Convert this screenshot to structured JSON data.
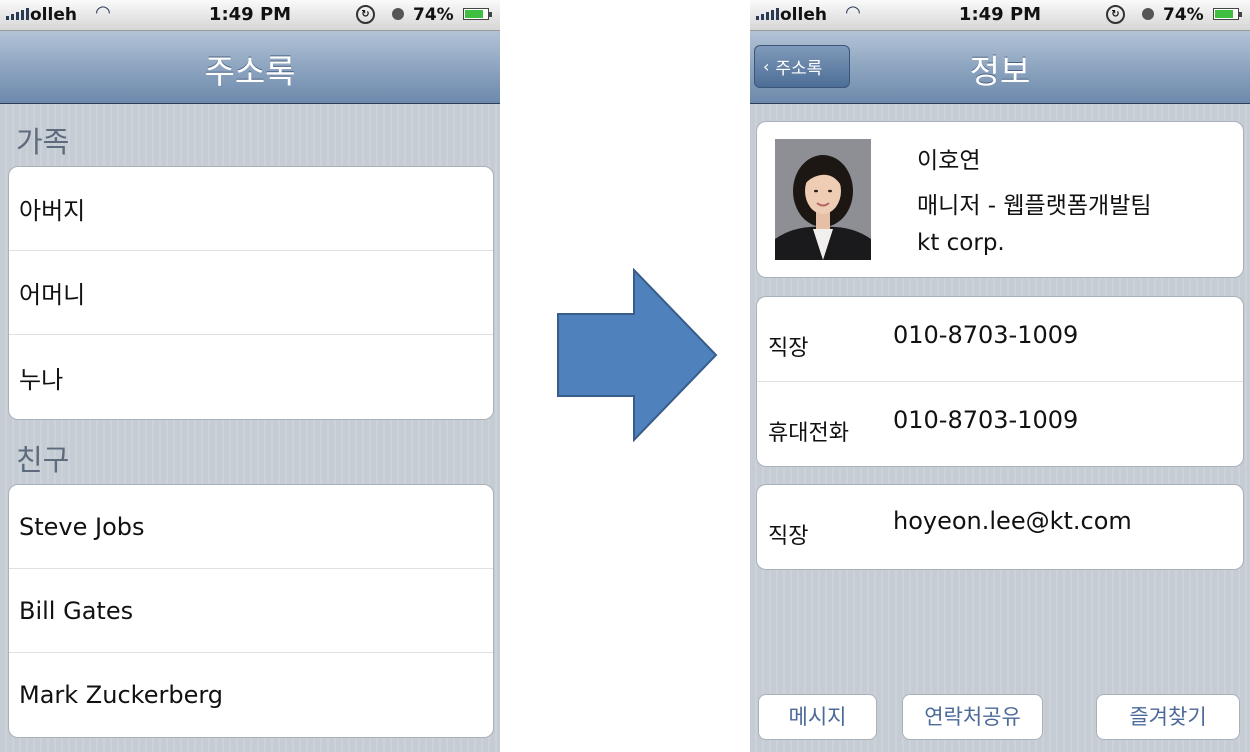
{
  "status_bar": {
    "carrier": "olleh",
    "time": "1:49 PM",
    "battery_percent": "74%",
    "battery_level": 0.74,
    "icons": [
      "signal-icon",
      "wifi-icon",
      "orientation-lock-icon",
      "alarm-icon",
      "battery-icon"
    ]
  },
  "address_book": {
    "title": "주소록",
    "sections": [
      {
        "header": "가족",
        "items": [
          "아버지",
          "어머니",
          "누나"
        ]
      },
      {
        "header": "친구",
        "items": [
          "Steve Jobs",
          "Bill Gates",
          "Mark Zuckerberg"
        ]
      }
    ]
  },
  "transition": {
    "icon": "right-arrow-icon",
    "color": "#4f81bd"
  },
  "contact_info": {
    "title": "정보",
    "back_label": "주소록",
    "name": "이호연",
    "position": "매니저 - 웹플랫폼개발팀",
    "company": "kt corp.",
    "phones": [
      {
        "label": "직장",
        "value": "010-8703-1009"
      },
      {
        "label": "휴대전화",
        "value": "010-8703-1009"
      }
    ],
    "email": {
      "label": "직장",
      "value": "hoyeon.lee@kt.com"
    },
    "actions": [
      "메시지",
      "연락처공유",
      "즐겨찾기"
    ]
  },
  "colors": {
    "navbar": "#7891b3",
    "background": "#c5ccd4",
    "section_header": "#5d6b7c",
    "action_text": "#4c6a99",
    "arrow": "#4f81bd"
  }
}
